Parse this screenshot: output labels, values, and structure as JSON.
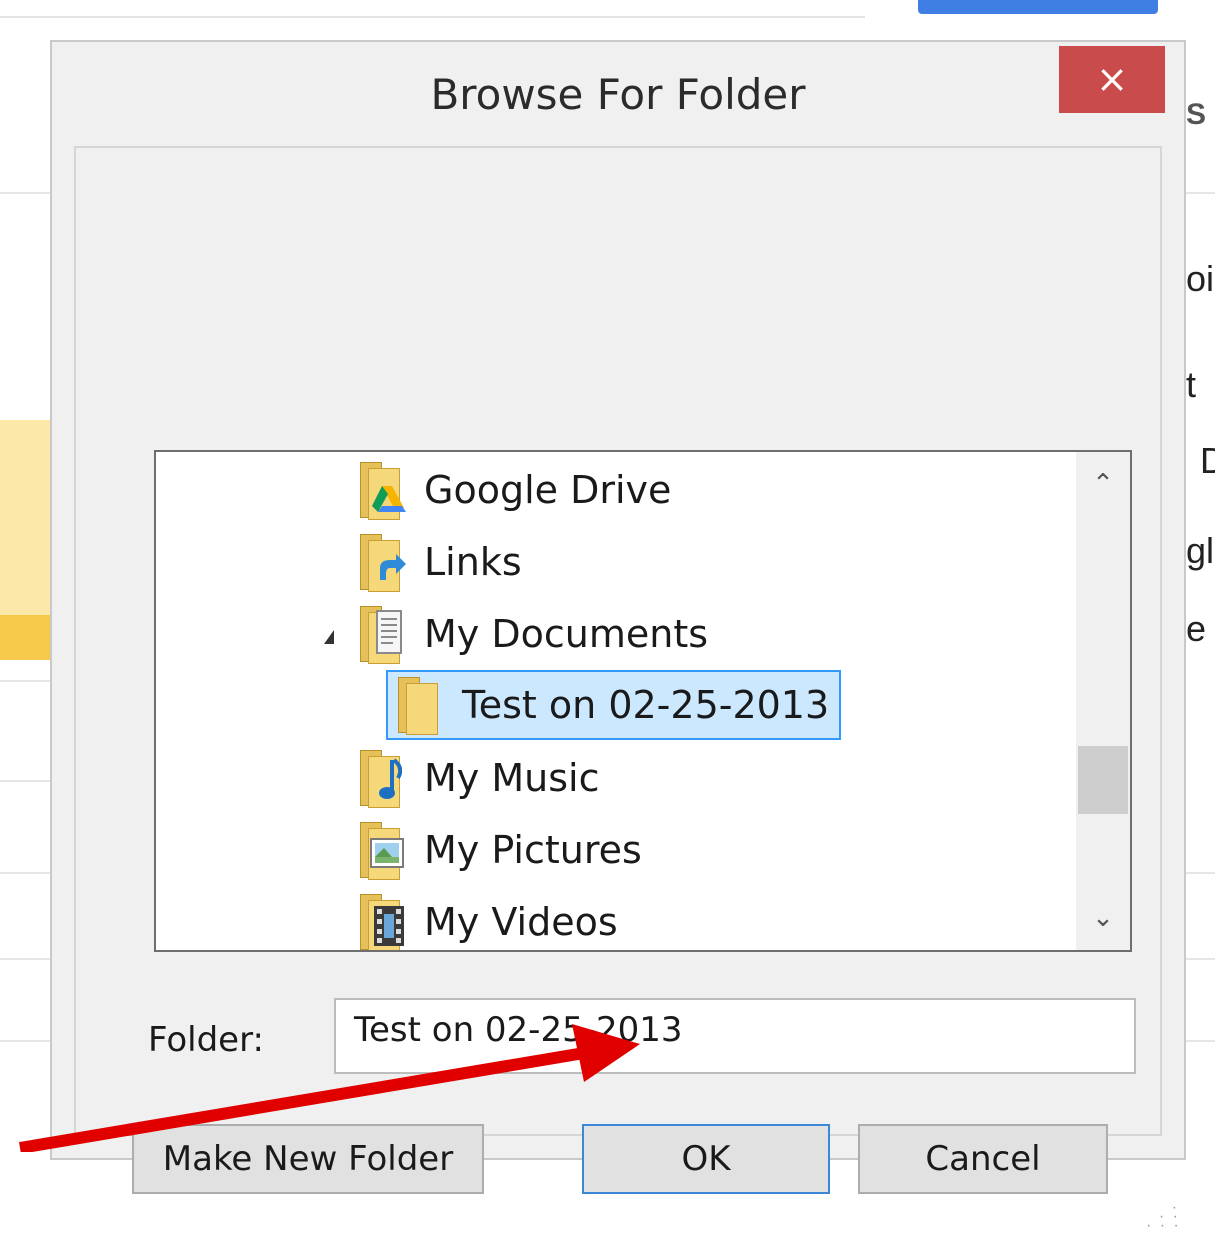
{
  "background": {
    "right_fragments": [
      "S",
      "oi",
      "t",
      "D",
      "gl",
      "e"
    ]
  },
  "dialog": {
    "title": "Browse For Folder",
    "close_label": "×",
    "tree": {
      "items": [
        {
          "label": "Google Drive",
          "icon": "google-drive-folder-icon"
        },
        {
          "label": "Links",
          "icon": "links-folder-icon"
        },
        {
          "label": "My Documents",
          "icon": "documents-folder-icon",
          "expanded": true
        },
        {
          "label": "Test on 02-25-2013",
          "icon": "folder-icon",
          "selected": true
        },
        {
          "label": "My Music",
          "icon": "music-folder-icon"
        },
        {
          "label": "My Pictures",
          "icon": "pictures-folder-icon"
        },
        {
          "label": "My Videos",
          "icon": "videos-folder-icon"
        }
      ],
      "scroll_up": "⌃",
      "scroll_down": "⌄"
    },
    "folder_label": "Folder:",
    "folder_value": "Test on 02-25-2013",
    "buttons": {
      "make_new_folder": "Make New Folder",
      "ok": "OK",
      "cancel": "Cancel"
    }
  },
  "colors": {
    "close_red": "#c94b4b",
    "selection_fill": "#cce8ff",
    "selection_border": "#3399ff",
    "annotation_arrow": "#e00000"
  }
}
